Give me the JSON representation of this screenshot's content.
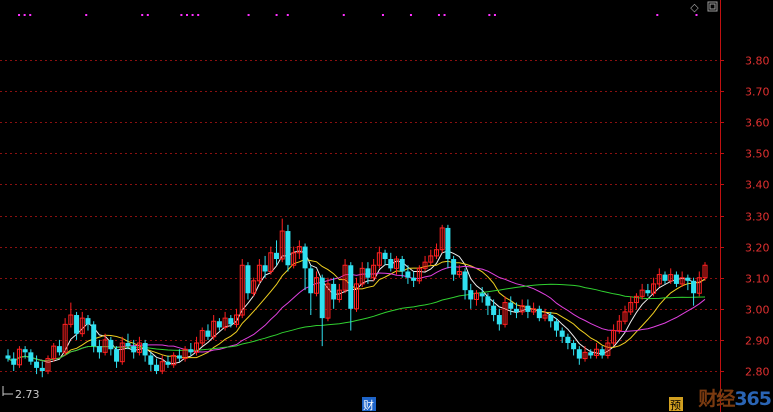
{
  "toolbar": {
    "diamond_icon": "diamond-icon",
    "window_icon": "restore-window-icon"
  },
  "watermark": {
    "text_a": "财经",
    "text_b": "365",
    "color_a": "#7a3a10",
    "color_b": "#2a64b4"
  },
  "markers": {
    "fin_label": "财",
    "fin_color": "#1e64c8",
    "forecast_label": "预",
    "forecast_color": "#d2a020"
  },
  "colors": {
    "up": "#ff2020",
    "down": "#30e0f0",
    "grid": "#8a1010",
    "axis": "#c01010",
    "ma_a": "#f0f0f0",
    "ma_b": "#f0d020",
    "ma_c": "#e040e0",
    "ma_d": "#30d030",
    "dots": "#ff30ff"
  },
  "chart_data": {
    "type": "candlestick",
    "y_axis": {
      "ticks": [
        "3.80",
        "3.70",
        "3.60",
        "3.50",
        "3.40",
        "3.30",
        "3.20",
        "3.10",
        "3.00",
        "2.90",
        "2.80"
      ],
      "ylim": [
        2.78,
        3.86
      ]
    },
    "low_marker": "2.73",
    "dot_groups": [
      [
        2,
        3,
        4
      ],
      [
        14
      ],
      [
        24,
        25
      ],
      [
        31,
        32,
        33,
        34
      ],
      [
        43
      ],
      [
        48,
        50
      ],
      [
        60
      ],
      [
        67
      ],
      [
        72
      ],
      [
        77,
        78
      ],
      [
        86,
        87
      ],
      [
        116
      ],
      [
        123
      ]
    ],
    "series_names": [],
    "candles": [
      [
        2.85,
        2.84,
        2.87,
        2.83
      ],
      [
        2.84,
        2.82,
        2.86,
        2.8
      ],
      [
        2.82,
        2.87,
        2.88,
        2.81
      ],
      [
        2.87,
        2.86,
        2.88,
        2.84
      ],
      [
        2.86,
        2.83,
        2.87,
        2.82
      ],
      [
        2.83,
        2.81,
        2.85,
        2.79
      ],
      [
        2.81,
        2.8,
        2.83,
        2.78
      ],
      [
        2.8,
        2.84,
        2.85,
        2.79
      ],
      [
        2.84,
        2.88,
        2.89,
        2.83
      ],
      [
        2.88,
        2.86,
        2.9,
        2.85
      ],
      [
        2.86,
        2.95,
        2.97,
        2.85
      ],
      [
        2.95,
        2.98,
        3.02,
        2.94
      ],
      [
        2.98,
        2.92,
        2.99,
        2.9
      ],
      [
        2.92,
        2.97,
        2.99,
        2.91
      ],
      [
        2.97,
        2.95,
        2.98,
        2.93
      ],
      [
        2.95,
        2.88,
        2.96,
        2.86
      ],
      [
        2.88,
        2.86,
        2.9,
        2.84
      ],
      [
        2.86,
        2.9,
        2.92,
        2.85
      ],
      [
        2.9,
        2.87,
        2.91,
        2.85
      ],
      [
        2.87,
        2.83,
        2.88,
        2.81
      ],
      [
        2.83,
        2.89,
        2.91,
        2.82
      ],
      [
        2.89,
        2.88,
        2.92,
        2.87
      ],
      [
        2.88,
        2.86,
        2.9,
        2.84
      ],
      [
        2.86,
        2.89,
        2.91,
        2.85
      ],
      [
        2.89,
        2.85,
        2.9,
        2.83
      ],
      [
        2.85,
        2.82,
        2.86,
        2.8
      ],
      [
        2.82,
        2.8,
        2.84,
        2.79
      ],
      [
        2.8,
        2.83,
        2.85,
        2.79
      ],
      [
        2.83,
        2.82,
        2.85,
        2.81
      ],
      [
        2.82,
        2.85,
        2.86,
        2.81
      ],
      [
        2.85,
        2.84,
        2.87,
        2.83
      ],
      [
        2.84,
        2.87,
        2.88,
        2.83
      ],
      [
        2.87,
        2.86,
        2.89,
        2.85
      ],
      [
        2.86,
        2.89,
        2.91,
        2.85
      ],
      [
        2.89,
        2.93,
        2.94,
        2.88
      ],
      [
        2.93,
        2.91,
        2.95,
        2.9
      ],
      [
        2.91,
        2.96,
        2.98,
        2.9
      ],
      [
        2.96,
        2.94,
        2.97,
        2.93
      ],
      [
        2.94,
        2.97,
        2.99,
        2.93
      ],
      [
        2.97,
        2.95,
        2.98,
        2.94
      ],
      [
        2.95,
        2.98,
        3.0,
        2.94
      ],
      [
        2.98,
        3.14,
        3.16,
        2.97
      ],
      [
        3.14,
        3.05,
        3.15,
        3.03
      ],
      [
        3.05,
        3.09,
        3.1,
        3.04
      ],
      [
        3.09,
        3.14,
        3.16,
        3.08
      ],
      [
        3.14,
        3.12,
        3.17,
        3.1
      ],
      [
        3.12,
        3.18,
        3.2,
        3.11
      ],
      [
        3.18,
        3.16,
        3.22,
        3.14
      ],
      [
        3.16,
        3.25,
        3.29,
        3.15
      ],
      [
        3.25,
        3.14,
        3.27,
        3.12
      ],
      [
        3.14,
        3.18,
        3.2,
        3.13
      ],
      [
        3.18,
        3.2,
        3.22,
        3.16
      ],
      [
        3.2,
        3.13,
        3.21,
        3.06
      ],
      [
        3.13,
        3.05,
        3.14,
        2.98
      ],
      [
        3.05,
        3.1,
        3.12,
        3.04
      ],
      [
        3.1,
        2.97,
        3.11,
        2.88
      ],
      [
        2.97,
        3.08,
        3.1,
        2.96
      ],
      [
        3.08,
        3.03,
        3.1,
        3.0
      ],
      [
        3.03,
        3.06,
        3.08,
        3.02
      ],
      [
        3.06,
        3.14,
        3.16,
        3.05
      ],
      [
        3.14,
        3.0,
        3.15,
        2.93
      ],
      [
        3.0,
        3.08,
        3.1,
        2.99
      ],
      [
        3.08,
        3.13,
        3.15,
        3.07
      ],
      [
        3.13,
        3.1,
        3.15,
        3.08
      ],
      [
        3.1,
        3.14,
        3.16,
        3.09
      ],
      [
        3.14,
        3.18,
        3.2,
        3.13
      ],
      [
        3.18,
        3.16,
        3.19,
        3.14
      ],
      [
        3.16,
        3.13,
        3.18,
        3.12
      ],
      [
        3.13,
        3.16,
        3.17,
        3.11
      ],
      [
        3.16,
        3.12,
        3.17,
        3.1
      ],
      [
        3.12,
        3.1,
        3.14,
        3.08
      ],
      [
        3.1,
        3.09,
        3.12,
        3.07
      ],
      [
        3.09,
        3.13,
        3.14,
        3.08
      ],
      [
        3.13,
        3.15,
        3.17,
        3.12
      ],
      [
        3.15,
        3.17,
        3.19,
        3.14
      ],
      [
        3.17,
        3.19,
        3.21,
        3.16
      ],
      [
        3.19,
        3.26,
        3.27,
        3.18
      ],
      [
        3.26,
        3.16,
        3.27,
        3.13
      ],
      [
        3.16,
        3.11,
        3.17,
        3.09
      ],
      [
        3.11,
        3.12,
        3.14,
        3.1
      ],
      [
        3.12,
        3.06,
        3.13,
        3.03
      ],
      [
        3.06,
        3.03,
        3.08,
        3.0
      ],
      [
        3.03,
        3.05,
        3.06,
        3.01
      ],
      [
        3.05,
        3.04,
        3.07,
        3.02
      ],
      [
        3.04,
        3.01,
        3.05,
        2.98
      ],
      [
        3.01,
        2.98,
        3.03,
        2.96
      ],
      [
        2.98,
        2.95,
        3.0,
        2.93
      ],
      [
        2.95,
        3.02,
        3.04,
        2.94
      ],
      [
        3.02,
        3.0,
        3.04,
        2.98
      ],
      [
        3.0,
        2.99,
        3.02,
        2.97
      ],
      [
        2.99,
        3.01,
        3.03,
        2.98
      ],
      [
        3.01,
        2.99,
        3.03,
        2.97
      ],
      [
        2.99,
        3.0,
        3.02,
        2.98
      ],
      [
        3.0,
        2.97,
        3.01,
        2.96
      ],
      [
        2.97,
        2.98,
        3.0,
        2.96
      ],
      [
        2.98,
        2.96,
        2.99,
        2.94
      ],
      [
        2.96,
        2.93,
        2.97,
        2.91
      ],
      [
        2.93,
        2.91,
        2.94,
        2.89
      ],
      [
        2.91,
        2.89,
        2.92,
        2.87
      ],
      [
        2.89,
        2.87,
        2.9,
        2.85
      ],
      [
        2.87,
        2.84,
        2.88,
        2.82
      ],
      [
        2.84,
        2.86,
        2.88,
        2.83
      ],
      [
        2.86,
        2.85,
        2.87,
        2.84
      ],
      [
        2.85,
        2.87,
        2.89,
        2.84
      ],
      [
        2.87,
        2.85,
        2.88,
        2.84
      ],
      [
        2.85,
        2.89,
        2.91,
        2.84
      ],
      [
        2.89,
        2.93,
        2.95,
        2.88
      ],
      [
        2.93,
        2.96,
        2.98,
        2.92
      ],
      [
        2.96,
        2.99,
        3.01,
        2.95
      ],
      [
        2.99,
        3.02,
        3.04,
        2.98
      ],
      [
        3.02,
        3.04,
        3.05,
        3.0
      ],
      [
        3.04,
        3.06,
        3.08,
        3.03
      ],
      [
        3.06,
        3.05,
        3.08,
        3.04
      ],
      [
        3.05,
        3.08,
        3.1,
        3.04
      ],
      [
        3.08,
        3.11,
        3.13,
        3.07
      ],
      [
        3.11,
        3.09,
        3.12,
        3.08
      ],
      [
        3.09,
        3.11,
        3.13,
        3.08
      ],
      [
        3.11,
        3.08,
        3.12,
        3.07
      ],
      [
        3.08,
        3.1,
        3.12,
        3.07
      ],
      [
        3.1,
        3.09,
        3.11,
        3.06
      ],
      [
        3.09,
        3.05,
        3.1,
        3.01
      ],
      [
        3.05,
        3.1,
        3.12,
        3.04
      ],
      [
        3.1,
        3.14,
        3.15,
        3.09
      ]
    ]
  }
}
